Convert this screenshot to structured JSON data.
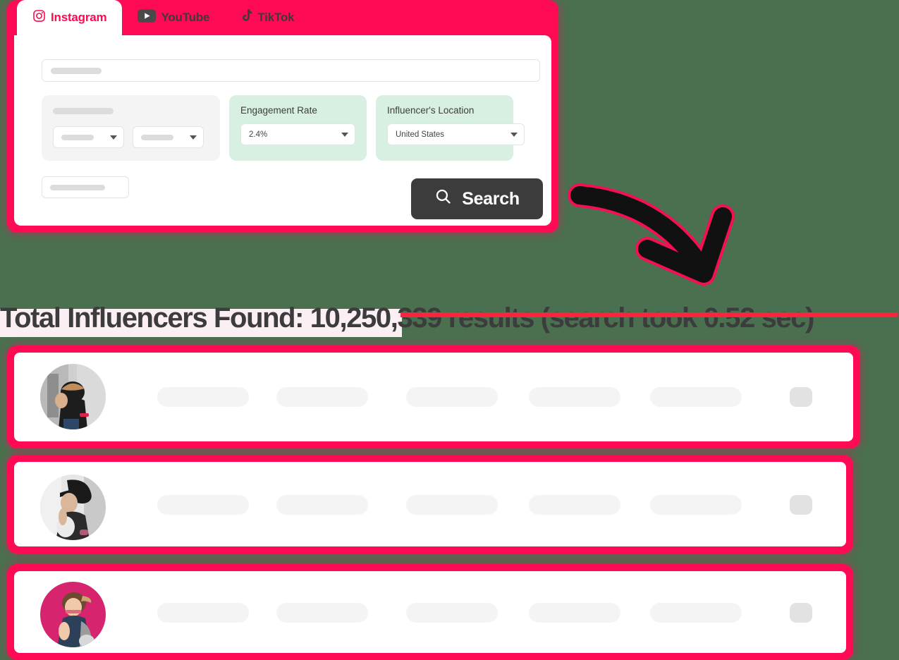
{
  "background_color": "#4a7050",
  "accent_color": "#ff0a54",
  "tabs": [
    {
      "id": "instagram",
      "label": "Instagram",
      "icon": "instagram-icon",
      "active": true
    },
    {
      "id": "youtube",
      "label": "YouTube",
      "icon": "youtube-icon",
      "active": false
    },
    {
      "id": "tiktok",
      "label": "TikTok",
      "icon": "tiktok-icon",
      "active": false
    }
  ],
  "search_panel": {
    "keyword_input": {
      "value": "",
      "placeholder": ""
    },
    "filters": [
      {
        "id": "category",
        "type": "gray",
        "label": "",
        "selects": [
          {
            "id": "select-a",
            "value": ""
          },
          {
            "id": "select-b",
            "value": ""
          }
        ]
      },
      {
        "id": "engagement-rate",
        "type": "green",
        "label": "Engagement Rate",
        "selects": [
          {
            "id": "engagement-rate-select",
            "value": "2.4%"
          }
        ]
      },
      {
        "id": "influencer-location",
        "type": "green",
        "label": "Influencer's Location",
        "selects": [
          {
            "id": "location-select",
            "value": "United States"
          }
        ]
      }
    ],
    "followers_input": {
      "value": "",
      "placeholder": ""
    },
    "search_button": {
      "label": "Search",
      "icon": "search-icon",
      "color": "#3c3c3c"
    }
  },
  "results_header": {
    "full_text": "Total Influencers Found: 10,250,339 results (search took 0.52 sec)",
    "highlighted_part": "Total Influencers Found: 10,2",
    "struck_part": "50,339 results (search took 0.52 sec)",
    "total_found": "10,250,339",
    "search_time": "0.52 sec",
    "highlight_color": "#fbeff4",
    "strike_color": "#f8253f"
  },
  "annotation": {
    "arrow": "curved-down-right-arrow",
    "color": "#111111",
    "glow": "#ff0a54"
  },
  "result_rows": [
    {
      "id": "row-1",
      "avatar": "photo-person-street-grayscale",
      "pill_count": 6
    },
    {
      "id": "row-2",
      "avatar": "photo-woman-hat-grayscale",
      "pill_count": 6
    },
    {
      "id": "row-3",
      "avatar": "photo-woman-pink-background",
      "pill_count": 6
    }
  ]
}
